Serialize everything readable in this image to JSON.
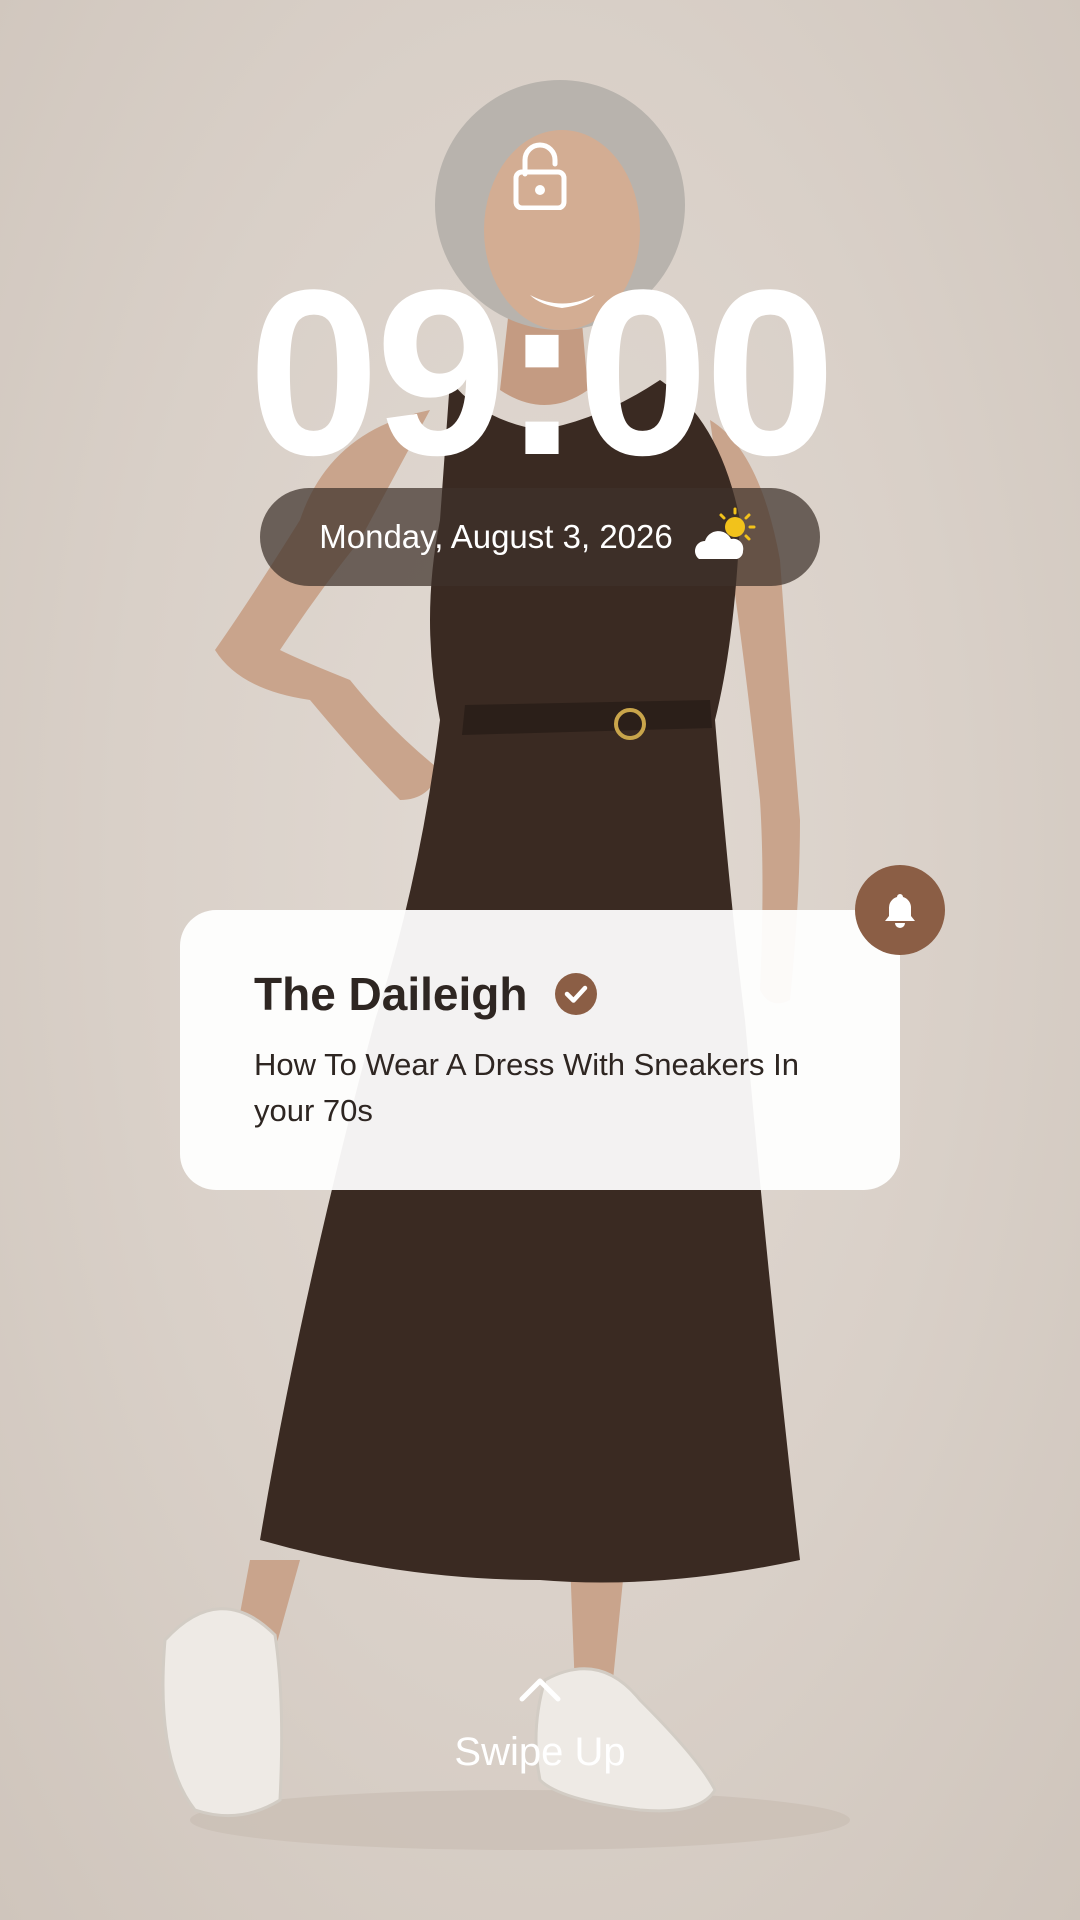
{
  "lockscreen": {
    "time": "09:00",
    "date": "Monday, August 3, 2026",
    "weather_icon": "partly-sunny-icon",
    "lock_icon": "unlocked-padlock-icon",
    "swipe_label": "Swipe Up"
  },
  "notification": {
    "app_name": "The Daileigh",
    "verified_icon": "verified-check-icon",
    "message": "How To Wear A Dress With Sneakers In your 70s",
    "bell_icon": "bell-icon"
  },
  "colors": {
    "accent": "#8b5e45",
    "dress": "#3a2a22",
    "pill_background": "#3e322b",
    "sun": "#f2c21b"
  }
}
